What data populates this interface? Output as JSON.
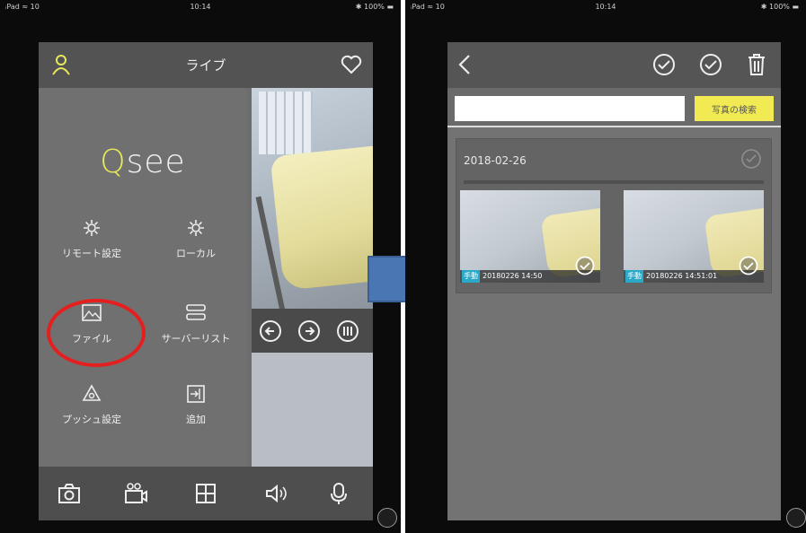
{
  "status_bar": {
    "left": "ᵢPad ≈ 10",
    "time": "10:14",
    "right": "✱ 100% ▬"
  },
  "left_screen": {
    "header": {
      "title": "ライブ",
      "user_icon": "user-icon",
      "favorite_icon": "heart-icon"
    },
    "logo": {
      "q": "Q",
      "rest": "see"
    },
    "menu": [
      {
        "label": "リモート設定",
        "icon": "gear-icon"
      },
      {
        "label": "ローカル",
        "icon": "gear-icon"
      },
      {
        "label": "ファイル",
        "icon": "image-file-icon"
      },
      {
        "label": "サーバーリスト",
        "icon": "server-list-icon"
      },
      {
        "label": "プッシュ設定",
        "icon": "push-gear-icon"
      },
      {
        "label": "追加",
        "icon": "add-device-icon"
      }
    ],
    "ptz_icons": [
      "arrow-left-circle-icon",
      "arrow-right-circle-icon",
      "grid-circle-icon"
    ],
    "bottom_icons": [
      "snapshot-icon",
      "record-icon",
      "layout-grid-icon",
      "speaker-icon",
      "talk-icon"
    ]
  },
  "right_screen": {
    "header_icons": [
      "back-icon",
      "select-icon",
      "select-all-icon",
      "trash-icon"
    ],
    "search": {
      "value": "",
      "placeholder": "",
      "button": "写真の検索"
    },
    "group": {
      "date": "2018-02-26",
      "thumbnails": [
        {
          "tag": "手動",
          "time": "20180226 14:50"
        },
        {
          "tag": "手動",
          "time": "20180226 14:51:01"
        }
      ]
    }
  },
  "colors": {
    "highlight": "#e41f1f",
    "accent_yellow": "#e7e85a",
    "arrow_blue": "#4a77b4"
  }
}
